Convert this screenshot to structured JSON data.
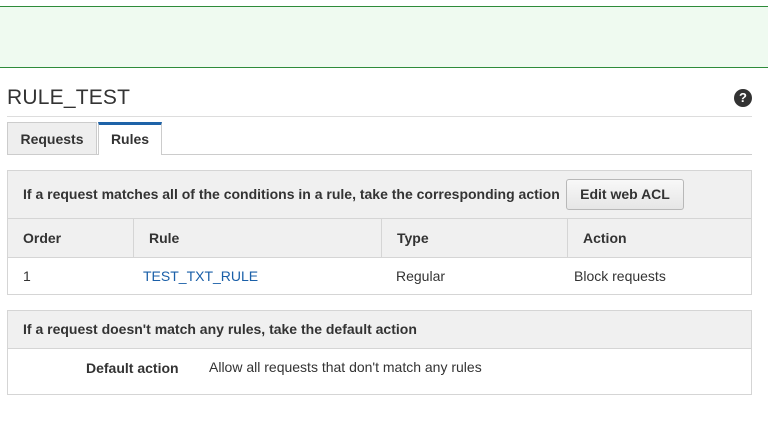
{
  "page": {
    "title": "RULE_TEST",
    "help_icon": "question-circle-icon"
  },
  "tabs": [
    {
      "label": "Requests",
      "active": false
    },
    {
      "label": "Rules",
      "active": true
    }
  ],
  "rules_panel": {
    "heading": "If a request matches all of the conditions in a rule, take the corresponding action",
    "edit_button": "Edit web ACL",
    "columns": [
      "Order",
      "Rule",
      "Type",
      "Action"
    ],
    "rows": [
      {
        "order": "1",
        "rule": "TEST_TXT_RULE",
        "type": "Regular",
        "action": "Block requests"
      }
    ]
  },
  "default_panel": {
    "heading": "If a request doesn't match any rules, take the default action",
    "label": "Default action",
    "value": "Allow all requests that don't match any rules"
  },
  "colors": {
    "banner_bg": "#effaf0",
    "banner_border": "#2e8b3a",
    "link": "#1a5fa8",
    "active_tab_accent": "#1e63a8"
  }
}
